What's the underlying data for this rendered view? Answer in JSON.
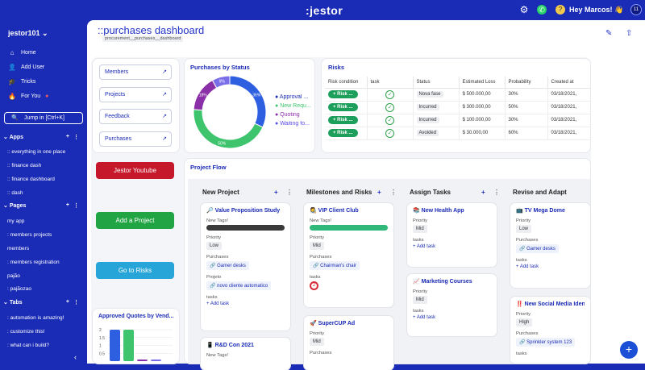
{
  "top": {
    "logo": ":jestor",
    "greeting": "Hey Marcos! 👋",
    "avatar_initial": "?",
    "badge": "11"
  },
  "sidebar": {
    "workspace": "jestor101",
    "nav": [
      {
        "icon": "⌂",
        "label": "Home"
      },
      {
        "icon": "👤",
        "label": "Add User"
      },
      {
        "icon": "🎓",
        "label": "Tricks"
      },
      {
        "icon": "🔥",
        "label": "For You"
      }
    ],
    "jump": "Jump in [Ctrl+K]",
    "apps_title": "Apps",
    "apps": [
      ":: everything in one place",
      ":: finance dash",
      ":: finance dashboard",
      ":: dash"
    ],
    "pages_title": "Pages",
    "pages": [
      "my app",
      ": members projects",
      "members",
      ": members registration",
      "pajão",
      ": pajãozao"
    ],
    "tabs_title": "Tabs",
    "tabs": [
      ": automation is amazing!",
      ": customize this!",
      ": what can i build?"
    ],
    "collapse": "‹"
  },
  "header": {
    "title": "::purchases dashboard",
    "slug": "procurement__purchases__dashboard",
    "edit_icon": "✎",
    "share_icon": "⇧"
  },
  "links": [
    "Members",
    "Projects",
    "Feedback",
    "Purchases"
  ],
  "cta": {
    "youtube": "Jestor Youtube",
    "add_project": "Add a Project",
    "risks": "Go to Risks",
    "colors": {
      "youtube": "#c5182a",
      "add": "#21a544",
      "risks": "#27a5d8"
    }
  },
  "pie": {
    "title": "Purchases by Status",
    "legend": [
      "Approval ...",
      "New Requ...",
      "Quoting",
      "Waiting fo..."
    ],
    "chart_data": {
      "type": "pie",
      "categories": [
        "Approval",
        "New Request",
        "Quoting",
        "Waiting for"
      ],
      "values": [
        36,
        50,
        18,
        9
      ],
      "labels": [
        "36%",
        "50%",
        "18%",
        "9%"
      ],
      "colors": [
        "#2d5fe0",
        "#3ec46d",
        "#8b2fa8",
        "#7a6de8"
      ]
    }
  },
  "risks": {
    "title": "Risks",
    "columns": [
      "Risk condition",
      "task",
      "Status",
      "Estimated Loss",
      "Probability",
      "Created at"
    ],
    "rows": [
      {
        "btn": "Risk ...",
        "status": "Nova fase",
        "loss": "$ 500.000,00",
        "prob": "30%",
        "date": "03/18/2021,"
      },
      {
        "btn": "Risk ...",
        "status": "Incurred",
        "loss": "$ 300.000,00",
        "prob": "50%",
        "date": "03/18/2021,"
      },
      {
        "btn": "Risk ...",
        "status": "Incurred",
        "loss": "$ 100.000,00",
        "prob": "30%",
        "date": "03/18/2021,"
      },
      {
        "btn": "Risk ...",
        "status": "Avoided",
        "loss": "$ 30.000,00",
        "prob": "60%",
        "date": "03/18/2021,"
      }
    ]
  },
  "quotes": {
    "title": "Approved Quotes by Vend...",
    "chart_data": {
      "type": "bar",
      "values": [
        2,
        2,
        0.1,
        0.1
      ],
      "colors": [
        "#2d5fe0",
        "#3ec46d",
        "#8b2fa8",
        "#7a6de8"
      ],
      "ylim": [
        0,
        2
      ],
      "yticks": [
        "2",
        "1.5",
        "1",
        "0.5"
      ]
    }
  },
  "flow": {
    "title": "Project Flow",
    "columns": [
      {
        "name": "New Project",
        "cards": [
          {
            "title": "🔎 Value Proposition Study",
            "tags_label": "New Tags!",
            "priority_label": "Priority",
            "priority": "Low",
            "purch_label": "Purchases",
            "purch": "Gamer desks",
            "proj_label": "Projeto",
            "proj": "novo cliente automatico",
            "tasks_label": "tasks",
            "add": "+ Add task"
          },
          {
            "title": "📱 R&D Con 2021",
            "tags_label": "New Tags!"
          }
        ]
      },
      {
        "name": "Milestones and Risks",
        "cards": [
          {
            "title": "👩‍🎨 VIP Client Club",
            "tags_label": "New Tags!",
            "priority_label": "Priority",
            "priority": "Mid",
            "purch_label": "Purchases",
            "purch": "Chairman's chair",
            "tasks_label": "tasks",
            "badge": "2"
          },
          {
            "title": "🚀 SuperCUP Ad",
            "priority_label": "Priority",
            "priority": "Mid",
            "purch_label": "Purchases"
          }
        ]
      },
      {
        "name": "Assign Tasks",
        "cards": [
          {
            "title": "📚 New Health App",
            "priority_label": "Priority",
            "priority": "Mid",
            "tasks_label": "tasks",
            "add": "+ Add task"
          },
          {
            "title": "📈 Marketing Courses",
            "priority_label": "Priority",
            "priority": "Mid",
            "tasks_label": "tasks",
            "add": "+ Add task"
          }
        ]
      },
      {
        "name": "Revise and Adapt",
        "cards": [
          {
            "title": "📺 TV Mega Dome",
            "priority_label": "Priority",
            "priority": "Low",
            "purch_label": "Purchases",
            "purch": "Gamer desks",
            "tasks_label": "tasks",
            "add": "+ Add task"
          },
          {
            "title": "‼️ New Social Media Identity",
            "priority_label": "Priority",
            "priority": "High",
            "purch_label": "Purchases",
            "purch": "Sprinkler system 123",
            "tasks_label": "tasks"
          }
        ]
      }
    ]
  },
  "fab": "+"
}
